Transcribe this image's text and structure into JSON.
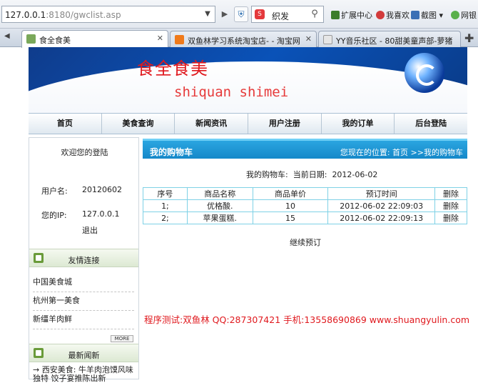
{
  "browser": {
    "url_host": "127.0.0.1",
    "url_path": ":8180/gwclist.asp",
    "search_value": "织发",
    "search_logo": "S",
    "toolbar": [
      "扩展中心",
      "我喜欢",
      "截图",
      "网银"
    ],
    "tabs": [
      {
        "label": "食全食美",
        "active": true
      },
      {
        "label": "双鱼林学习系统淘宝店- - 淘宝网",
        "active": false
      },
      {
        "label": "YY音乐社区 - 80甜美童声部-萝猪",
        "active": false
      }
    ]
  },
  "banner": {
    "title_cn": "食全食美",
    "title_en": "shiquan shimei"
  },
  "nav": [
    "首页",
    "美食查询",
    "新闻资讯",
    "用户注册",
    "我的订单",
    "后台登陆"
  ],
  "sidebar": {
    "welcome": "欢迎您的登陆",
    "username_label": "用户名:",
    "username_value": "20120602",
    "ip_label": "您的IP:",
    "ip_value": "127.0.0.1",
    "logout": "退出",
    "links_title": "友情连接",
    "links": [
      "中国美食城",
      "杭州第一美食",
      "新缰羊肉鲜"
    ],
    "more": "MORE",
    "news_title": "最新闻新",
    "news": [
      "西安美食: 牛羊肉泡馍风味独特 饺子宴推陈出新"
    ]
  },
  "content": {
    "title": "我的购物车",
    "breadcrumb": "您现在的位置: 首页 >>我的购物车",
    "cart_label": "我的购物车:",
    "date_label": "当前日期:",
    "date_value": "2012-06-02",
    "columns": [
      "序号",
      "商品名称",
      "商品单价",
      "预订时间",
      "删除"
    ],
    "rows": [
      [
        "1;",
        "优格酸.",
        "10",
        "2012-06-02 22:09:03",
        "删除"
      ],
      [
        "2;",
        "苹果蛋糕.",
        "15",
        "2012-06-02 22:09:13",
        "删除"
      ]
    ],
    "continue": "继续预订",
    "footer_note": "程序测试:双鱼林 QQ:287307421 手机:13558690869 www.shuangyulin.com"
  }
}
